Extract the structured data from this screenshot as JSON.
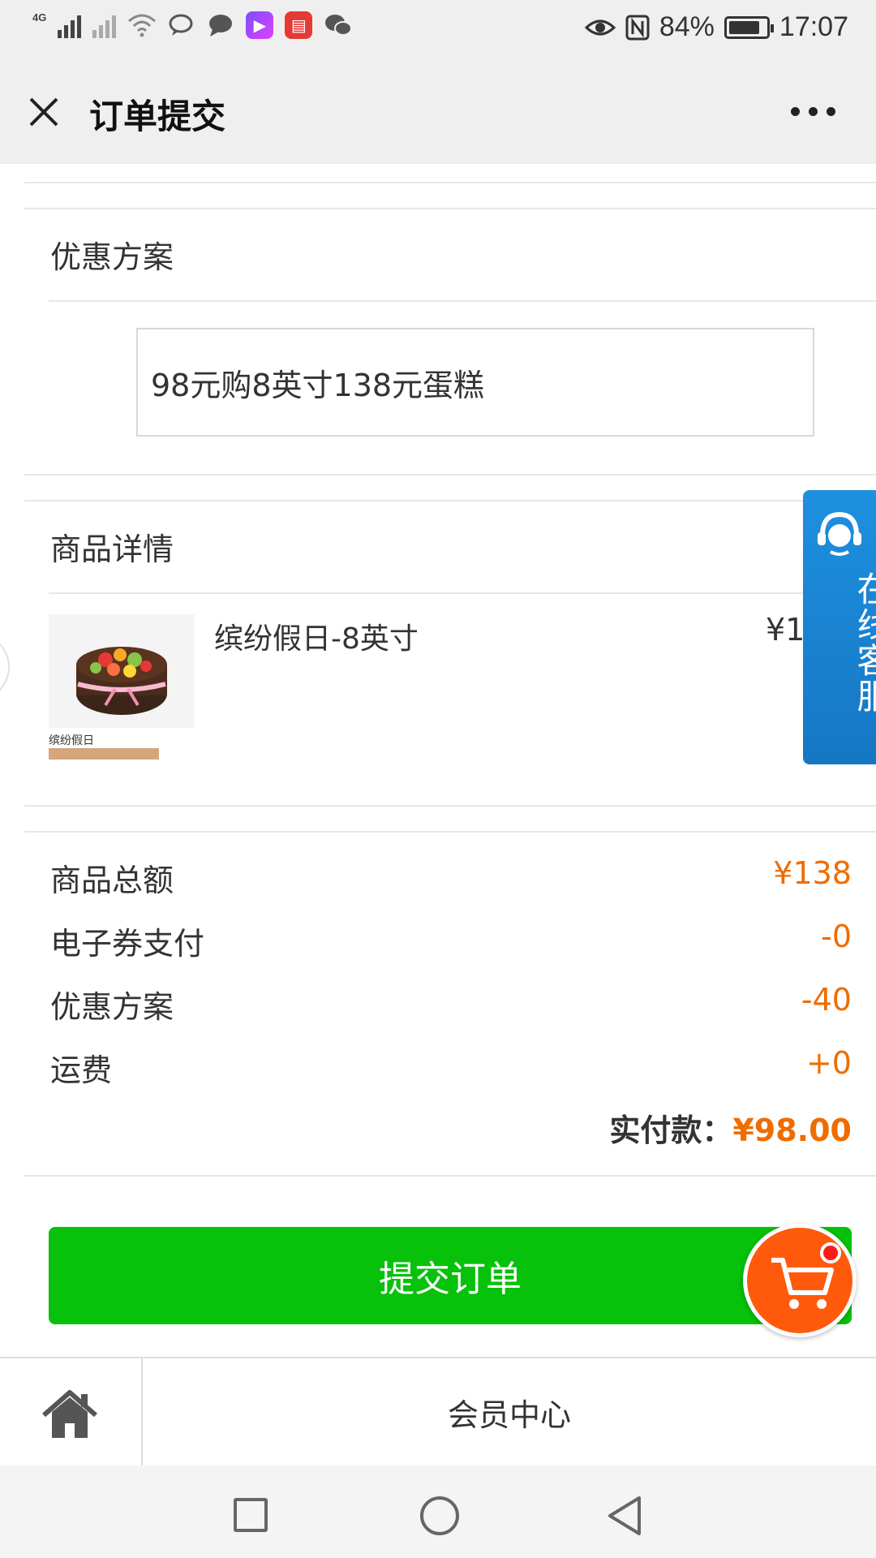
{
  "status_bar": {
    "network": "4G",
    "battery": "84%",
    "time": "17:07"
  },
  "header": {
    "title": "订单提交",
    "close_icon": "close-icon",
    "more_icon": "more-icon"
  },
  "promotion": {
    "title": "优惠方案",
    "selected_option": "98元购8英寸138元蛋糕"
  },
  "product": {
    "section_title": "商品详情",
    "name": "缤纷假日-8英寸",
    "price_partial": "¥1",
    "thumb_label": "缤纷假日"
  },
  "customer_service": {
    "label": "在线客服"
  },
  "summary": {
    "rows": [
      {
        "label": "商品总额",
        "value": "¥138"
      },
      {
        "label": "电子券支付",
        "value": "-0"
      },
      {
        "label": "优惠方案",
        "value": "-40"
      },
      {
        "label": "运费",
        "value": "+0"
      }
    ],
    "total_label": "实付款：",
    "total_value": "¥98.00"
  },
  "actions": {
    "submit_label": "提交订单"
  },
  "bottom_nav": {
    "home_icon": "home-icon",
    "member_center": "会员中心"
  },
  "colors": {
    "accent_orange": "#ef6c00",
    "submit_green": "#07c10b",
    "service_blue": "#1e90e0"
  }
}
